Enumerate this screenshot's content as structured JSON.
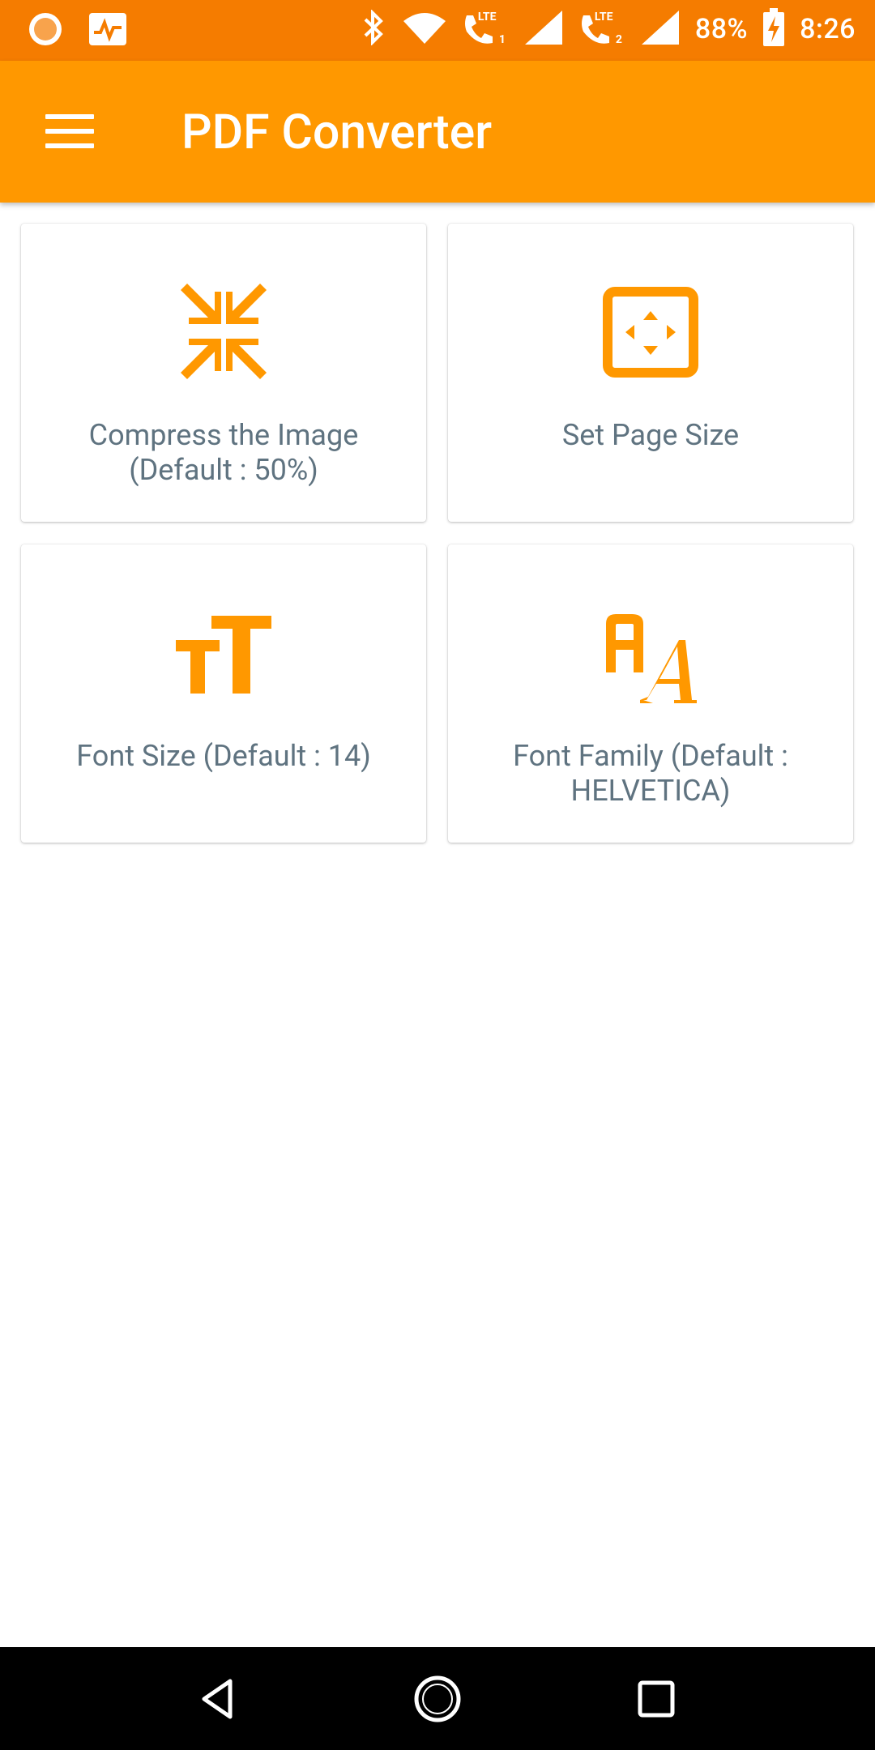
{
  "status_bar": {
    "battery_percent": "88%",
    "time": "8:26",
    "sim1_label": "LTE",
    "sim1_index": "1",
    "sim2_label": "LTE",
    "sim2_index": "2"
  },
  "app_bar": {
    "title": "PDF Converter"
  },
  "cards": [
    {
      "label": "Compress the Image (Default : 50%)",
      "icon": "compress-icon"
    },
    {
      "label": "Set Page Size",
      "icon": "page-size-icon"
    },
    {
      "label": "Font Size (Default : 14)",
      "icon": "font-size-icon"
    },
    {
      "label": "Font Family (Default : HELVETICA)",
      "icon": "font-family-icon"
    }
  ],
  "colors": {
    "status_bar": "#F57C00",
    "app_bar": "#FF9800",
    "accent_icon": "#FF9800",
    "card_text": "#5f7380"
  }
}
